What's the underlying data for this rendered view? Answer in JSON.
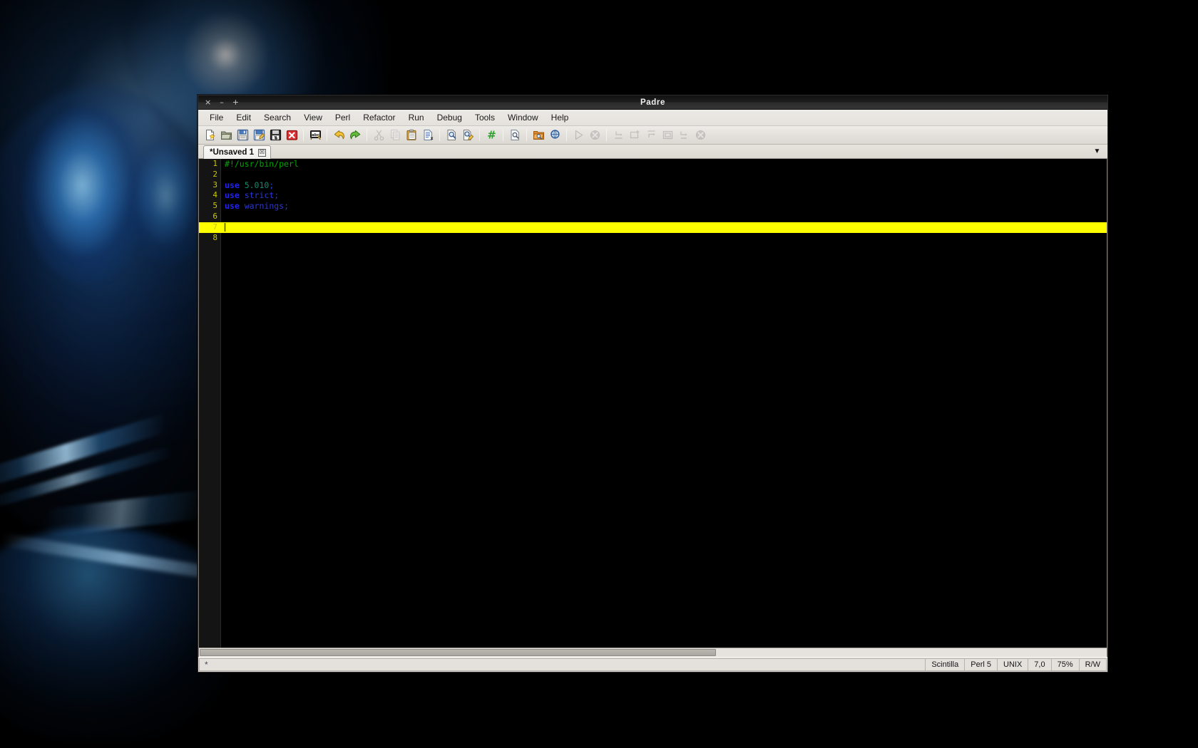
{
  "window": {
    "title": "Padre",
    "controls": [
      {
        "name": "close-button",
        "glyph": "×"
      },
      {
        "name": "minimize-button",
        "glyph": "–"
      },
      {
        "name": "maximize-button",
        "glyph": "+"
      }
    ]
  },
  "menubar": {
    "items": [
      {
        "label": "File"
      },
      {
        "label": "Edit"
      },
      {
        "label": "Search"
      },
      {
        "label": "View"
      },
      {
        "label": "Perl"
      },
      {
        "label": "Refactor"
      },
      {
        "label": "Run"
      },
      {
        "label": "Debug"
      },
      {
        "label": "Tools"
      },
      {
        "label": "Window"
      },
      {
        "label": "Help"
      }
    ]
  },
  "toolbar": {
    "groups": [
      {
        "buttons": [
          {
            "icon": "new-file-icon",
            "label": "New File",
            "enabled": true
          },
          {
            "icon": "open-file-icon",
            "label": "Open File",
            "enabled": true
          },
          {
            "icon": "save-icon",
            "label": "Save File",
            "enabled": true
          },
          {
            "icon": "save-as-icon",
            "label": "Save File As",
            "enabled": true
          },
          {
            "icon": "save-all-icon",
            "label": "Save All",
            "enabled": true
          },
          {
            "icon": "close-file-icon",
            "label": "Close File",
            "enabled": true
          }
        ]
      },
      {
        "buttons": [
          {
            "icon": "spell-check-icon",
            "label": "Check Spelling",
            "enabled": true
          }
        ]
      },
      {
        "buttons": [
          {
            "icon": "undo-icon",
            "label": "Undo",
            "enabled": true
          },
          {
            "icon": "redo-icon",
            "label": "Redo",
            "enabled": true
          }
        ]
      },
      {
        "buttons": [
          {
            "icon": "cut-icon",
            "label": "Cut",
            "enabled": false
          },
          {
            "icon": "copy-icon",
            "label": "Copy",
            "enabled": false
          },
          {
            "icon": "paste-icon",
            "label": "Paste",
            "enabled": true
          },
          {
            "icon": "select-all-icon",
            "label": "Select All",
            "enabled": true
          }
        ]
      },
      {
        "buttons": [
          {
            "icon": "find-icon",
            "label": "Find",
            "enabled": true
          },
          {
            "icon": "replace-icon",
            "label": "Find/Replace",
            "enabled": true
          }
        ]
      },
      {
        "buttons": [
          {
            "icon": "goto-line-icon",
            "label": "Go To Line",
            "enabled": true
          }
        ]
      },
      {
        "buttons": [
          {
            "icon": "doc-stats-icon",
            "label": "Document Statistics",
            "enabled": true
          }
        ]
      },
      {
        "buttons": [
          {
            "icon": "browse-dir-icon",
            "label": "Directory Browser",
            "enabled": true
          },
          {
            "icon": "find-in-files-icon",
            "label": "Find in Files",
            "enabled": true
          }
        ]
      },
      {
        "buttons": [
          {
            "icon": "run-script-icon",
            "label": "Run Script",
            "enabled": false
          },
          {
            "icon": "stop-script-icon",
            "label": "Stop Script",
            "enabled": false
          }
        ]
      },
      {
        "buttons": [
          {
            "icon": "step-in-icon",
            "label": "Step In",
            "enabled": false
          },
          {
            "icon": "step-over-icon",
            "label": "Step Over",
            "enabled": false
          },
          {
            "icon": "step-out-icon",
            "label": "Step Out",
            "enabled": false
          },
          {
            "icon": "run-till-icon",
            "label": "Run Until Breakpoint",
            "enabled": false
          },
          {
            "icon": "display-value-icon",
            "label": "Display Value",
            "enabled": false
          },
          {
            "icon": "quit-debugger-icon",
            "label": "Quit Debugger",
            "enabled": false
          }
        ]
      }
    ]
  },
  "tabs": {
    "items": [
      {
        "label": "*Unsaved 1",
        "close_glyph": "☒",
        "active": true
      }
    ],
    "dropdown_glyph": "▼"
  },
  "editor": {
    "background": "#000000",
    "gutter_background": "#141414",
    "line_number_color": "#c8c800",
    "current_line_color": "#ffff00",
    "current_line": 7,
    "lines": [
      {
        "n": "1",
        "tokens": [
          {
            "t": "#!/usr/bin/perl",
            "c": "tok-comment"
          }
        ]
      },
      {
        "n": "2",
        "tokens": []
      },
      {
        "n": "3",
        "tokens": [
          {
            "t": "use ",
            "c": "tok-kw"
          },
          {
            "t": "5.010",
            "c": "tok-num"
          },
          {
            "t": ";",
            "c": "tok-punc"
          }
        ]
      },
      {
        "n": "4",
        "tokens": [
          {
            "t": "use ",
            "c": "tok-kw"
          },
          {
            "t": "strict",
            "c": "tok-word"
          },
          {
            "t": ";",
            "c": "tok-punc"
          }
        ]
      },
      {
        "n": "5",
        "tokens": [
          {
            "t": "use ",
            "c": "tok-kw"
          },
          {
            "t": "warnings",
            "c": "tok-word"
          },
          {
            "t": ";",
            "c": "tok-punc"
          }
        ]
      },
      {
        "n": "6",
        "tokens": []
      },
      {
        "n": "7",
        "tokens": []
      },
      {
        "n": "8",
        "tokens": []
      }
    ]
  },
  "statusbar": {
    "message": "*",
    "cells": [
      {
        "name": "status-editor-engine",
        "value": "Scintilla"
      },
      {
        "name": "status-mime-type",
        "value": "Perl 5"
      },
      {
        "name": "status-line-ending",
        "value": "UNIX"
      },
      {
        "name": "status-cursor-pos",
        "value": "7,0"
      },
      {
        "name": "status-zoom",
        "value": "75%"
      },
      {
        "name": "status-read-write",
        "value": "R/W"
      }
    ]
  }
}
